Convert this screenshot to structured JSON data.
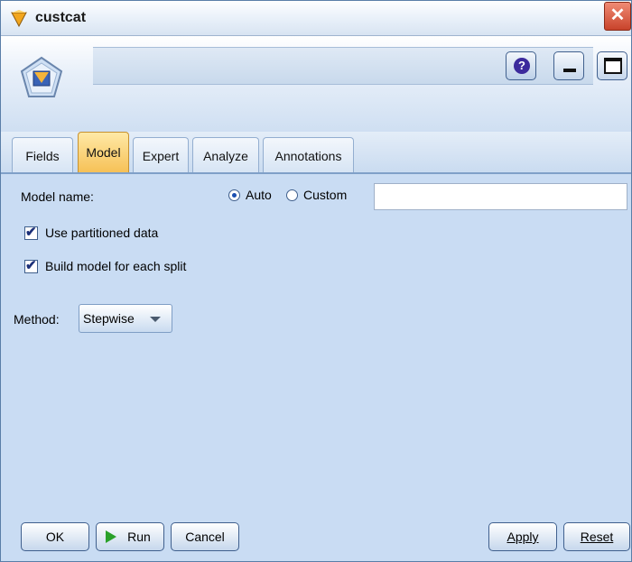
{
  "window": {
    "title": "custcat",
    "close_label": "✕"
  },
  "header": {
    "help_label": "?",
    "minimize_label": "",
    "maximize_label": ""
  },
  "tabs": [
    {
      "label": "Fields",
      "active": false
    },
    {
      "label": "Model",
      "active": true
    },
    {
      "label": "Expert",
      "active": false
    },
    {
      "label": "Analyze",
      "active": false
    },
    {
      "label": "Annotations",
      "active": false
    }
  ],
  "model": {
    "model_name_label": "Model name:",
    "auto_label": "Auto",
    "custom_label": "Custom",
    "selected_name_mode": "Auto",
    "custom_name_value": "",
    "use_partitioned_label": "Use partitioned data",
    "use_partitioned_checked": true,
    "build_each_split_label": "Build model for each split",
    "build_each_split_checked": true,
    "method_label": "Method:",
    "method_value": "Stepwise"
  },
  "footer": {
    "ok_label": "OK",
    "run_label": "Run",
    "cancel_label": "Cancel",
    "apply_label": "Apply",
    "reset_label": "Reset"
  },
  "colors": {
    "panel_bg": "#c9dcf3",
    "active_tab": "#f6c055",
    "run_icon": "#2aa12a",
    "close_button": "#c8432b"
  }
}
